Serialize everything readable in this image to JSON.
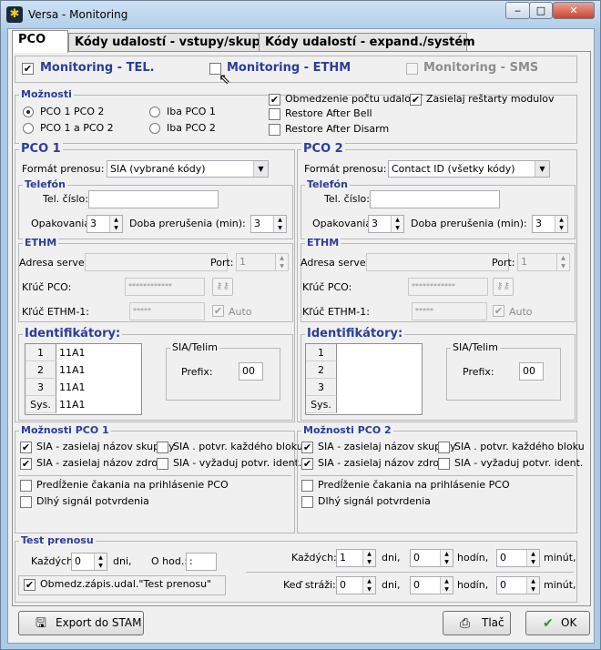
{
  "window": {
    "title": "Versa - Monitoring",
    "minimize": "‒",
    "maximize": "□",
    "close": "✕"
  },
  "tabs": [
    "PCO",
    "Kódy udalostí - vstupy/skup.",
    "Kódy udalostí - expand./systém"
  ],
  "monitoring": {
    "tel": "Monitoring - TEL.",
    "ethm": "Monitoring - ETHM",
    "sms": "Monitoring - SMS"
  },
  "moznosti": {
    "title": "Možnosti",
    "r1": "PCO 1 PCO 2",
    "r2": "PCO 1 a PCO 2",
    "r3": "Iba PCO 1",
    "r4": "Iba PCO 2",
    "c1": "Obmedzenie počtu udalostí",
    "c2": "Zasielaj reštarty modulov",
    "c3": "Restore After Bell",
    "c4": "Restore After Disarm"
  },
  "pco1": {
    "title": "PCO 1",
    "format_label": "Formát prenosu:",
    "format": "SIA (vybrané kódy)",
    "tel_title": "Telefón",
    "tel_label": "Tel. číslo:",
    "tel_value": "",
    "opak_label": "Opakovania:",
    "opak": "3",
    "doba_label": "Doba prerušenia (min):",
    "doba": "3",
    "ethm_title": "ETHM",
    "adresa_label": "Adresa servera",
    "port_label": "Port:",
    "port": "1",
    "kluc_label": "Kľúč PCO:",
    "kluc": "************",
    "kluc2_label": "Kľúč ETHM-1:",
    "kluc2": "*****",
    "auto": "Auto",
    "id_title": "Identifikátory:",
    "ids": [
      {
        "h": "1",
        "v": "11A1"
      },
      {
        "h": "2",
        "v": "11A1"
      },
      {
        "h": "3",
        "v": "11A1"
      },
      {
        "h": "Sys.",
        "v": "11A1"
      }
    ],
    "sia_title": "SIA/Telim",
    "prefix_label": "Prefix:",
    "prefix": "00",
    "opt_title": "Možnosti PCO 1",
    "o1": "SIA - zasielaj názov skupiny",
    "o2": "SIA . potvr. každého bloku",
    "o3": "SIA - zasielaj názov zdroja",
    "o4": "SIA - vyžaduj potvr. ident.",
    "o5": "Predĺženie čakania na prihlásenie PCO",
    "o6": "Dlhý signál potvrdenia"
  },
  "pco2": {
    "title": "PCO 2",
    "format_label": "Formát prenosu:",
    "format": "Contact ID (všetky kódy)",
    "tel_title": "Telefón",
    "tel_label": "Tel. číslo:",
    "tel_value": "",
    "opak_label": "Opakovania:",
    "opak": "3",
    "doba_label": "Doba prerušenia (min):",
    "doba": "3",
    "ethm_title": "ETHM",
    "adresa_label": "Adresa servera",
    "port_label": "Port:",
    "port": "1",
    "kluc_label": "Kľúč PCO:",
    "kluc": "************",
    "kluc2_label": "Kľúč ETHM-1:",
    "kluc2": "*****",
    "auto": "Auto",
    "id_title": "Identifikátory:",
    "ids": [
      {
        "h": "1",
        "v": ""
      },
      {
        "h": "2",
        "v": ""
      },
      {
        "h": "3",
        "v": ""
      },
      {
        "h": "Sys.",
        "v": ""
      }
    ],
    "sia_title": "SIA/Telim",
    "prefix_label": "Prefix:",
    "prefix": "00",
    "opt_title": "Možnosti PCO 2",
    "o1": "SIA - zasielaj názov skupiny",
    "o2": "SIA . potvr. každého bloku",
    "o3": "SIA - zasielaj názov zdroja",
    "o4": "SIA - vyžaduj potvr. ident.",
    "o5": "Predĺženie čakania na prihlásenie PCO",
    "o6": "Dlhý signál potvrdenia"
  },
  "test": {
    "title": "Test prenosu",
    "kazdych": "Každých:",
    "days": "0",
    "dni": "dni,",
    "ohod": "O hod.:",
    "time": ":",
    "obmedz": "Obmedz.zápis.udal.\"Test prenosu\"",
    "r_kazdych": "Každých:",
    "r1_days": "1",
    "r1_hours": "0",
    "r1_min": "0",
    "r_strazi": "Keď stráži:",
    "r2_days": "0",
    "r2_hours": "0",
    "r2_min": "0",
    "dni2": "dni,",
    "hodin": "hodín,",
    "minut": "minút,"
  },
  "buttons": {
    "export": "Export do STAM",
    "tlac": "Tlač",
    "ok": "OK"
  }
}
